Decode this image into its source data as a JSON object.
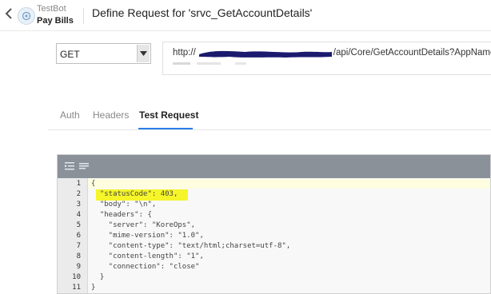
{
  "header": {
    "bot_name": "TestBot",
    "task_name": "Pay Bills",
    "title": "Define Request for 'srvc_GetAccountDetails'"
  },
  "request": {
    "method": "GET",
    "url_prefix": "http://",
    "url_suffix": "/api/Core/GetAccountDetails?AppName="
  },
  "tabs": [
    {
      "label": "Auth",
      "active": false
    },
    {
      "label": "Headers",
      "active": false
    },
    {
      "label": "Test Request",
      "active": true
    }
  ],
  "editor": {
    "line_numbers": [
      "1",
      "2",
      "3",
      "4",
      "5",
      "6",
      "7",
      "8",
      "9",
      "10",
      "11"
    ],
    "lines": [
      "{",
      "  \"statusCode\": 403,",
      "  \"body\": \"\\n\",",
      "  \"headers\": {",
      "    \"server\": \"KoreOps\",",
      "    \"mime-version\": \"1.0\",",
      "    \"content-type\": \"text/html;charset=utf-8\",",
      "    \"content-length\": \"1\",",
      "    \"connection\": \"close\"",
      "  }",
      "}"
    ]
  },
  "colors": {
    "tab_accent": "#2b7de9",
    "toolbar": "#8a9199",
    "highlight": "#f5f52a",
    "redaction": "#1a1a6e"
  }
}
